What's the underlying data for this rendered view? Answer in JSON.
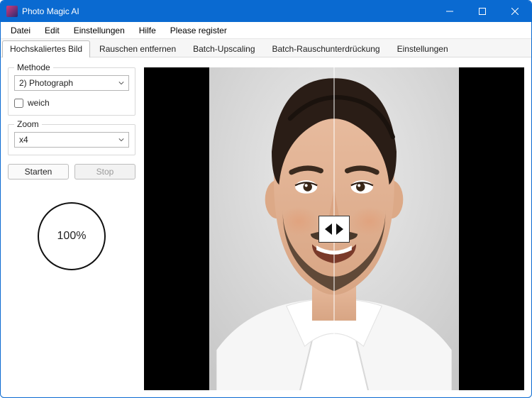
{
  "window": {
    "title": "Photo Magic AI"
  },
  "menu": {
    "items": [
      "Datei",
      "Edit",
      "Einstellungen",
      "Hilfe",
      "Please register"
    ]
  },
  "tabs": {
    "items": [
      {
        "label": "Hochskaliertes Bild",
        "active": true
      },
      {
        "label": "Rauschen entfernen",
        "active": false
      },
      {
        "label": "Batch-Upscaling",
        "active": false
      },
      {
        "label": "Batch-Rauschunterdrückung",
        "active": false
      },
      {
        "label": "Einstellungen",
        "active": false
      }
    ]
  },
  "panel": {
    "method": {
      "legend": "Methode",
      "value": "2) Photograph",
      "soft_label": "weich",
      "soft_checked": false
    },
    "zoom": {
      "legend": "Zoom",
      "value": "x4"
    },
    "buttons": {
      "start": "Starten",
      "stop": "Stop",
      "stop_enabled": false
    },
    "progress": {
      "text": "100%"
    }
  }
}
